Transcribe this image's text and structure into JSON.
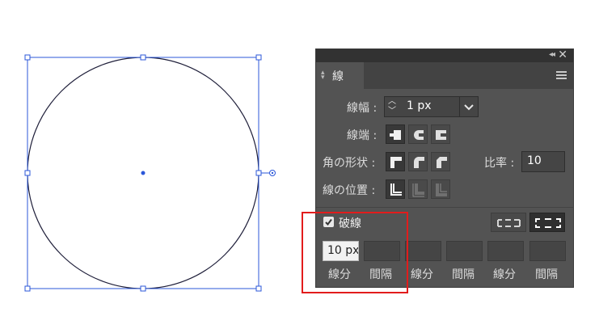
{
  "panel": {
    "tab_label": "線",
    "collapse_glyph": "◂◂",
    "close_glyph": "✕",
    "weight": {
      "label": "線幅 :",
      "value": "1 px"
    },
    "cap": {
      "label": "線端 :"
    },
    "corner": {
      "label": "角の形状 :"
    },
    "ratio": {
      "label": "比率 :",
      "value": "10"
    },
    "align": {
      "label": "線の位置 :"
    },
    "dashed": {
      "checked": true,
      "label": "破線",
      "fields": [
        {
          "value": "10 px",
          "label": "線分"
        },
        {
          "value": "",
          "label": "間隔"
        },
        {
          "value": "",
          "label": "線分"
        },
        {
          "value": "",
          "label": "間隔"
        },
        {
          "value": "",
          "label": "線分"
        },
        {
          "value": "",
          "label": "間隔"
        }
      ]
    }
  },
  "colors": {
    "panel_bg": "#535353",
    "selection_blue": "#2b57d9",
    "highlight_red": "#e21c1c"
  },
  "icons": [
    "chevron-up-down-icon",
    "chevron-down-icon",
    "menu-icon",
    "close-icon",
    "butt-cap-icon",
    "round-cap-icon",
    "projecting-cap-icon",
    "miter-join-icon",
    "round-join-icon",
    "bevel-join-icon",
    "align-center-icon",
    "align-inside-icon",
    "align-outside-icon",
    "checkbox-icon",
    "dash-exact-icon",
    "dash-align-corners-icon"
  ]
}
